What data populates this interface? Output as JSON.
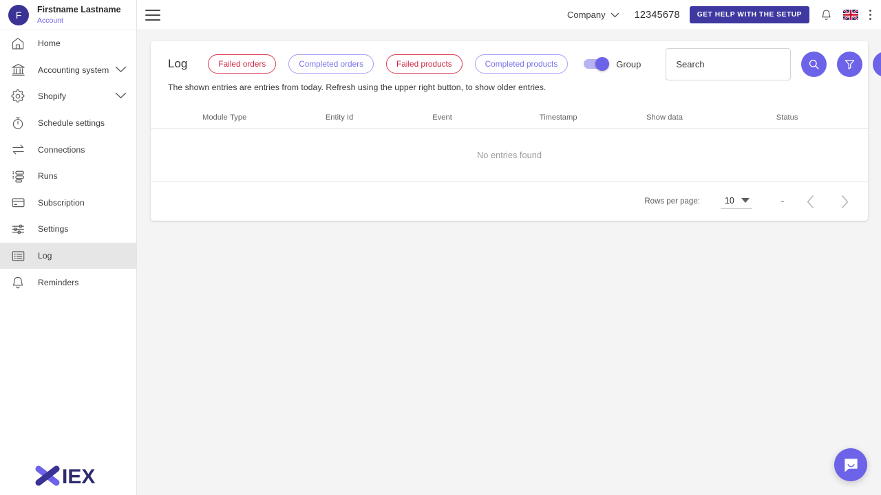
{
  "sidebar": {
    "user": {
      "avatar_initial": "F",
      "name": "Firstname Lastname",
      "account_link": "Account"
    },
    "items": [
      {
        "label": "Home",
        "icon": "home-icon",
        "expandable": false
      },
      {
        "label": "Accounting system",
        "icon": "bank-icon",
        "expandable": true
      },
      {
        "label": "Shopify",
        "icon": "gear-icon",
        "expandable": true
      },
      {
        "label": "Schedule settings",
        "icon": "stopwatch-icon",
        "expandable": false
      },
      {
        "label": "Connections",
        "icon": "transfer-arrows-icon",
        "expandable": false
      },
      {
        "label": "Runs",
        "icon": "runs-list-icon",
        "expandable": false
      },
      {
        "label": "Subscription",
        "icon": "credit-card-icon",
        "expandable": false
      },
      {
        "label": "Settings",
        "icon": "sliders-icon",
        "expandable": false
      },
      {
        "label": "Log",
        "icon": "log-list-icon",
        "expandable": false,
        "active": true
      },
      {
        "label": "Reminders",
        "icon": "bell-icon",
        "expandable": false
      }
    ],
    "logo_text": "IEX"
  },
  "topbar": {
    "menu_icon": "hamburger-icon",
    "company_label": "Company",
    "org_number": "12345678",
    "help_button": "GET HELP WITH THE SETUP",
    "notification_icon": "bell-icon",
    "language_flag": "uk-flag-icon",
    "overflow_icon": "kebab-menu-icon"
  },
  "main": {
    "title": "Log",
    "chips": [
      {
        "label": "Failed orders",
        "tone": "red"
      },
      {
        "label": "Completed orders",
        "tone": "blue"
      },
      {
        "label": "Failed products",
        "tone": "red"
      },
      {
        "label": "Completed products",
        "tone": "blue"
      }
    ],
    "group_toggle": {
      "label": "Group",
      "on": true
    },
    "search": {
      "placeholder": "Search",
      "value": ""
    },
    "actions": [
      {
        "name": "search-button",
        "icon": "magnifier-icon"
      },
      {
        "name": "filter-button",
        "icon": "funnel-icon"
      },
      {
        "name": "refresh-button",
        "icon": "refresh-icon"
      }
    ],
    "note": "The shown entries are entries from today. Refresh using the upper right button, to show older entries.",
    "table": {
      "columns": [
        "Module",
        "Type",
        "Entity Id",
        "Event",
        "Timestamp",
        "Show data",
        "Status"
      ],
      "rows": [],
      "empty_message": "No entries found"
    },
    "pagination": {
      "rows_per_page_label": "Rows per page:",
      "rows_per_page_value": "10",
      "range_text": "-",
      "prev_icon": "chevron-left-icon",
      "next_icon": "chevron-right-icon"
    }
  },
  "chat": {
    "icon": "chat-bubble-icon"
  },
  "colors": {
    "accent": "#6c63e8",
    "brand_dark": "#3b3296",
    "help_button": "#3f38a0",
    "chip_red": "#cf2b45",
    "chip_blue": "#7a72ec",
    "page_bg": "#f4f4f5"
  }
}
